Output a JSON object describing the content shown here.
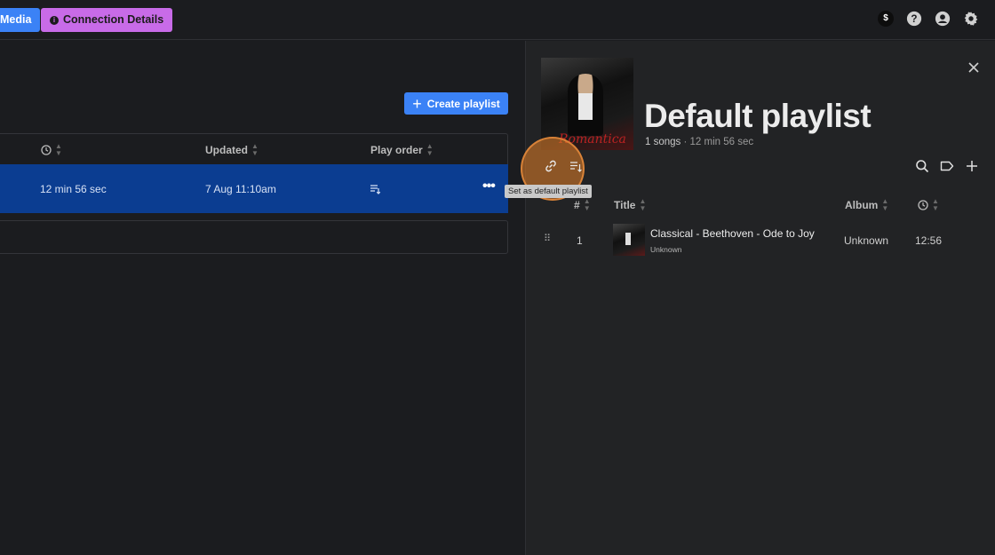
{
  "topbar": {
    "media_label": "Media",
    "connection_label": "Connection Details",
    "icons": [
      "dollar-icon",
      "help-icon",
      "account-icon",
      "settings-icon"
    ],
    "dollar_symbol": "$"
  },
  "left": {
    "create_playlist_label": "Create playlist",
    "columns": {
      "updated": "Updated",
      "play_order": "Play order"
    },
    "row": {
      "duration": "12 min 56 sec",
      "updated": "7 Aug 11:10am",
      "more": "•••"
    }
  },
  "right": {
    "title": "Default playlist",
    "song_count": "1 songs",
    "duration": "12 min 56 sec",
    "tooltip": "Set as default playlist",
    "columns": {
      "number": "#",
      "title": "Title",
      "album": "Album"
    },
    "tracks": [
      {
        "number": "1",
        "title": "Classical - Beethoven - Ode to Joy (",
        "artist": "Unknown",
        "album": "Unknown",
        "time": "12:56"
      }
    ],
    "cover_text": "Romantica"
  },
  "colors": {
    "accent_blue": "#3b82f6",
    "connection_purple": "#c86be8",
    "selected_row": "#0b3d91",
    "highlight_orange": "#d67828"
  }
}
